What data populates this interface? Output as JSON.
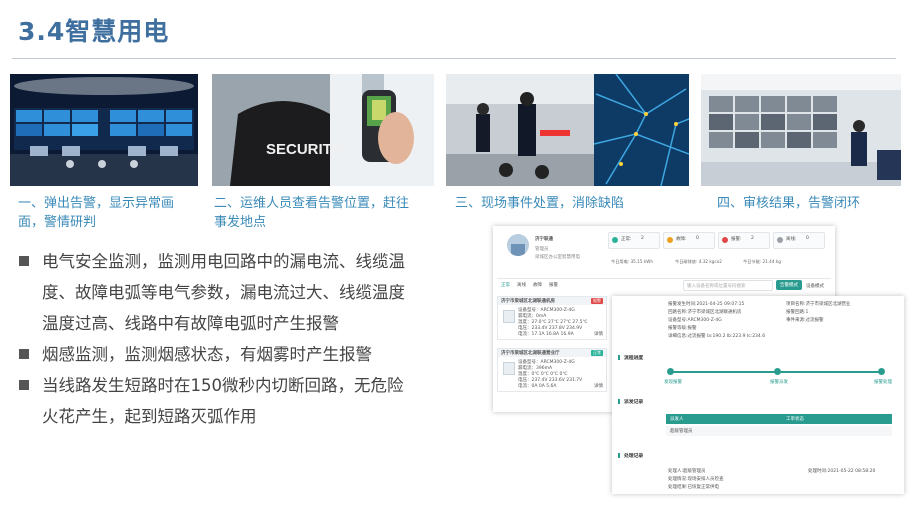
{
  "slide": {
    "title": "3.4智慧用电"
  },
  "steps": [
    {
      "caption_lines": [
        "一、弹出告警，显示异常画",
        "面，警情研判"
      ]
    },
    {
      "caption_lines": [
        "二、运维人员查看告警位置，赶往",
        "事发地点"
      ]
    },
    {
      "caption_lines": [
        "三、现场事件处置，消除缺陷"
      ]
    },
    {
      "caption_lines": [
        "四、审核结果，告警闭环"
      ]
    }
  ],
  "photos": {
    "security_text": "SECURITY"
  },
  "bullets": [
    {
      "lines": [
        "电气安全监测，监测用电回路中的漏电流、线缆温",
        "度、故障电弧等电气参数，漏电流过大、线缆温度",
        "温度过高、线路中有故障电弧时产生报警"
      ]
    },
    {
      "lines": [
        "烟感监测，监测烟感状态，有烟雾时产生报警"
      ]
    },
    {
      "lines": [
        "当线路发生短路时在150微秒内切断回路，无危险",
        "火花产生，起到短路灭弧作用"
      ]
    }
  ],
  "screenshot": {
    "user": {
      "name": "济宁联通",
      "role": "管理员",
      "org": "梁城区办公室智慧用电"
    },
    "chips": [
      {
        "label": "正常:",
        "value": "2",
        "color": "#2bb39a"
      },
      {
        "label": "故障:",
        "value": "0",
        "color": "#f0a020"
      },
      {
        "label": "报警:",
        "value": "2",
        "color": "#e04848"
      },
      {
        "label": "离线:",
        "value": "0",
        "color": "#9aa0a6"
      }
    ],
    "stats": [
      {
        "label": "今日用电:",
        "value": "35.15 kWh"
      },
      {
        "label": "今日碳排放:",
        "value": "4.32 kgco2"
      },
      {
        "label": "今日节能:",
        "value": "21.44 kg"
      }
    ],
    "tabs": [
      "正常",
      "离线",
      "故障",
      "报警"
    ],
    "search_placeholder": "输入设备名称或位置号码搜索",
    "mode_active": "告警模式",
    "mode_inactive": "设备模式",
    "cards": [
      {
        "name": "济宁市梁城区北湖联通机房",
        "status": "报警",
        "status_color": "#e04848",
        "rows": [
          "设备型号：ARCM300-Z-4G",
          "漏电流：0mA",
          "温度：27.0℃ 27℃ 27℃ 27.5℃",
          "电压：233.4V 237.8V 234.9V",
          "电流：17.1A 16.8A 16.9A"
        ],
        "detail": "详情"
      },
      {
        "name": "济宁市梁城区北湖联通营业厅",
        "status": "正常",
        "status_color": "#2bb39a",
        "rows": [
          "设备型号：ARCM300-Z-4G",
          "漏电流：396mA",
          "温度：0℃ 0℃ 0℃ 0℃",
          "电压：237.4V 233.6V 231.7V",
          "电流：0A 0A 5.6A"
        ],
        "detail": "详情"
      }
    ],
    "detail_panel": {
      "info_left": [
        "报警发生时间:2021-04-25 09:07:15",
        "回路名称:济宁市梁城区北湖联通机房",
        "设备型号:ARCM300-Z-4G",
        "报警等级:报警",
        "详细信息:过流报警 Ia:190.2 Ib:223.9 Ic:234.6"
      ],
      "info_right": [
        "项目名称:济宁市梁城区北湖营业",
        "报警回路:1",
        "事件来源:过流报警"
      ],
      "process_title": "流程进度",
      "process_steps": [
        "发现报警",
        "报警派发",
        "报警处理"
      ],
      "dispatch_title": "派发记录",
      "dispatch_head": [
        "派发人",
        "工单状态"
      ],
      "dispatch_row": "超级管理员",
      "handle_title": "处理记录",
      "handle_rows": [
        "处理人:超级管理员",
        "处理情况:现场安排人员检查",
        "处理结果:已恢复正常供电",
        "处理时间:2021-05-22 08:58:20"
      ]
    }
  }
}
